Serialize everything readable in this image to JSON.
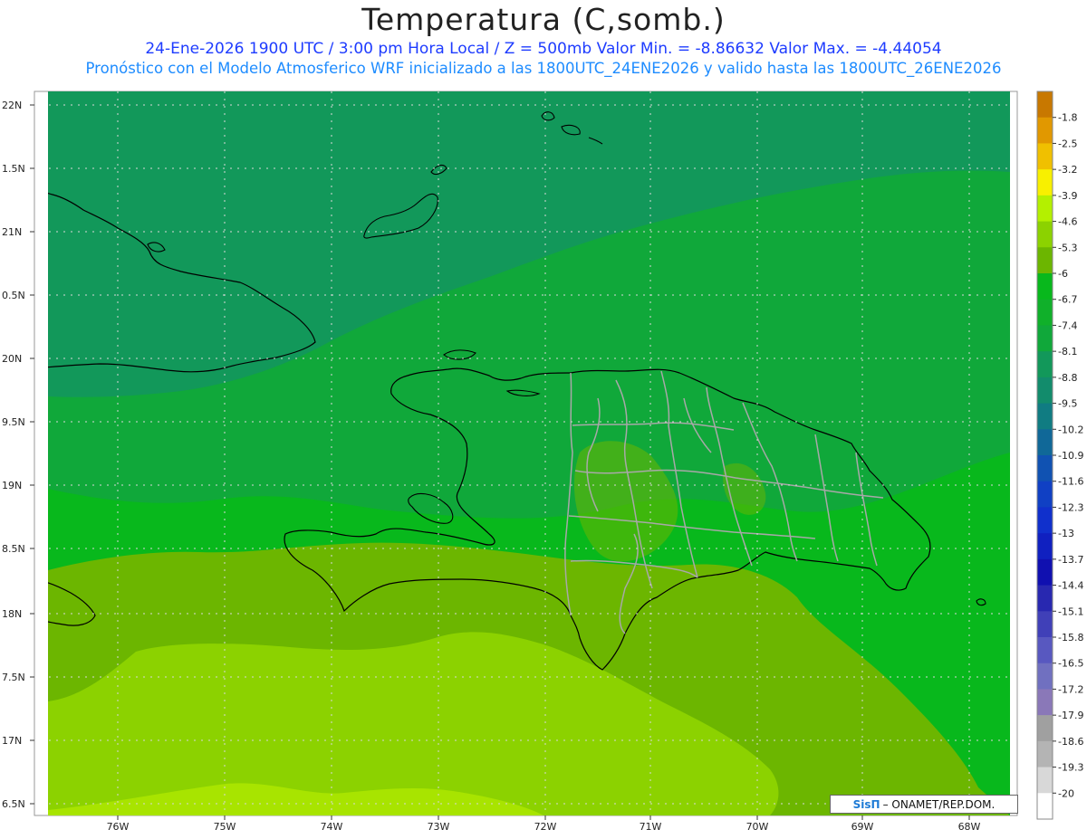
{
  "header": {
    "title": "Temperatura (C,somb.)",
    "subtitle1": "24-Ene-2026  1900 UTC / 3:00 pm Hora Local / Z = 500mb  Valor Min. = -8.86632  Valor Max. = -4.44054",
    "subtitle2": "Pronóstico con el Modelo Atmosferico WRF inicializado a las 1800UTC_24ENE2026 y valido hasta las  1800UTC_26ENE2026"
  },
  "map": {
    "lat_labels": [
      "22N",
      "1.5N",
      "21N",
      "0.5N",
      "20N",
      "9.5N",
      "19N",
      "8.5N",
      "18N",
      "7.5N",
      "17N",
      "6.5N"
    ],
    "lon_labels": [
      "76W",
      "75W",
      "74W",
      "73W",
      "72W",
      "71W",
      "70W",
      "69W",
      "68W"
    ],
    "field_colors": {
      "dark": "#12985a",
      "mid": "#10a83a",
      "light": "#08b81c",
      "warm": "#6cb600",
      "warmer": "#8cd200",
      "warmest": "#a8e400"
    }
  },
  "colorbar": {
    "labels": [
      "-1.8",
      "-2.5",
      "-3.2",
      "-3.9",
      "-4.6",
      "-5.3",
      "-6",
      "-6.7",
      "-7.4",
      "-8.1",
      "-8.8",
      "-9.5",
      "-10.2",
      "-10.9",
      "-11.6",
      "-12.3",
      "-13",
      "-13.7",
      "-14.4",
      "-15.1",
      "-15.8",
      "-16.5",
      "-17.2",
      "-17.9",
      "-18.6",
      "-19.3",
      "-20"
    ],
    "colors": [
      "#c87800",
      "#e19800",
      "#f0c000",
      "#f8f000",
      "#b4f000",
      "#8cd200",
      "#6cb600",
      "#08b81c",
      "#10b02a",
      "#10a83a",
      "#12985a",
      "#128c6c",
      "#107c82",
      "#106898",
      "#1052b2",
      "#1040c4",
      "#1030cc",
      "#1020c0",
      "#1010b0",
      "#2828b0",
      "#4040b8",
      "#5858c0",
      "#7070c0",
      "#8a78b8",
      "#a0a0a0",
      "#b4b4b4",
      "#d8d8d8",
      "#ffffff"
    ]
  },
  "credit": {
    "logo": "SisΠ",
    "text": "– ONAMET/REP.DOM."
  }
}
